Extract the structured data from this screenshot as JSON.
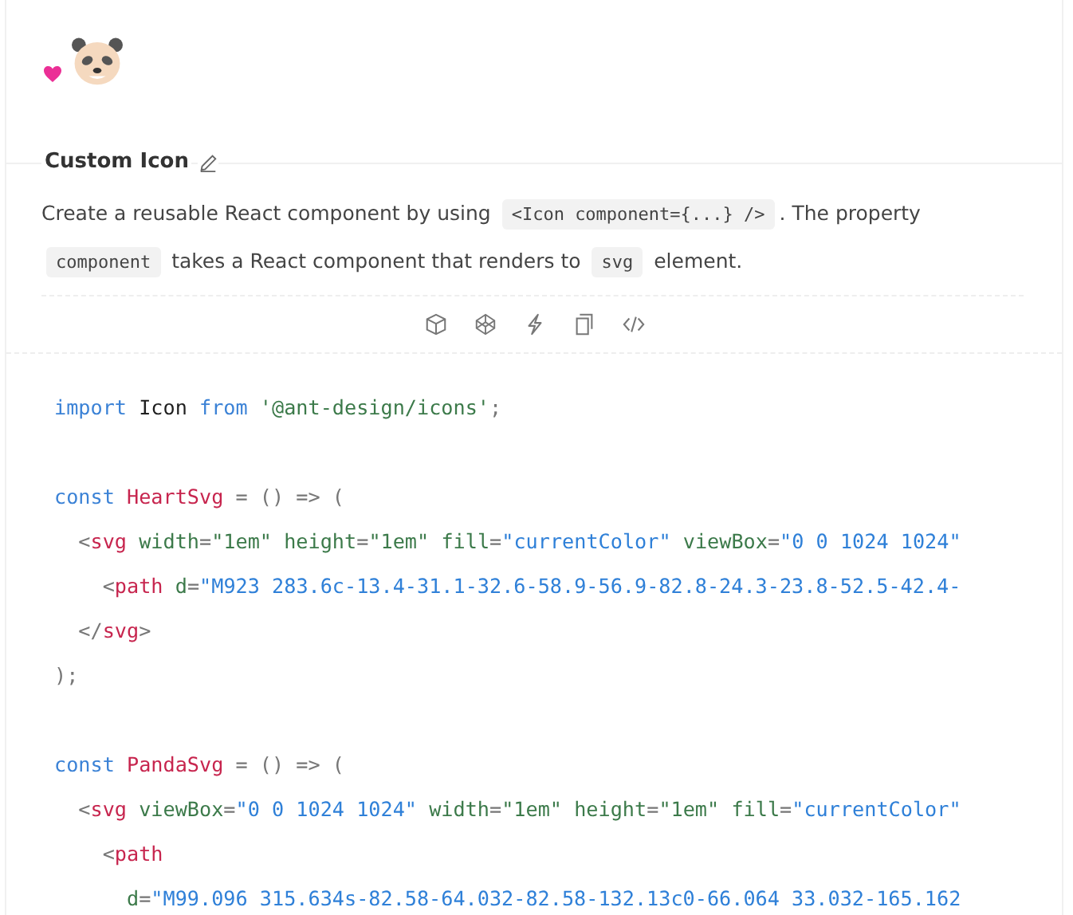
{
  "demo": {
    "icons": [
      {
        "kind": "heart"
      },
      {
        "kind": "panda"
      }
    ]
  },
  "section": {
    "title": "Custom Icon",
    "description": [
      "Create a reusable React component by using ",
      "<Icon component={...} />",
      ". The property ",
      "component",
      " takes a React component that renders to ",
      "svg",
      " element."
    ]
  },
  "actions": [
    {
      "kind": "codesandbox"
    },
    {
      "kind": "codepen"
    },
    {
      "kind": "stackblitz"
    },
    {
      "kind": "copy"
    },
    {
      "kind": "expand"
    }
  ],
  "code": [
    {
      "lines": [
        [
          {
            "kind": "keyword",
            "text": "import"
          },
          {
            "kind": "plain",
            "text": " Icon "
          },
          {
            "kind": "keyword",
            "text": "from"
          },
          {
            "kind": "string",
            "text": " '@ant-design/icons'"
          },
          {
            "kind": "punct",
            "text": ";"
          }
        ]
      ]
    },
    {
      "lines": [
        [
          {
            "kind": "keyword",
            "text": "const"
          },
          {
            "kind": "name",
            "text": " HeartSvg"
          },
          {
            "kind": "punct",
            "text": " = () => ("
          }
        ],
        [
          {
            "kind": "punct",
            "text": "  <"
          },
          {
            "kind": "tag",
            "text": "svg"
          },
          {
            "kind": "attr",
            "text": " width"
          },
          {
            "kind": "punct",
            "text": "="
          },
          {
            "kind": "string",
            "text": "\"1em\""
          },
          {
            "kind": "attr",
            "text": " height"
          },
          {
            "kind": "punct",
            "text": "="
          },
          {
            "kind": "string",
            "text": "\"1em\""
          },
          {
            "kind": "attr",
            "text": " fill"
          },
          {
            "kind": "punct",
            "text": "="
          },
          {
            "kind": "value",
            "text": "\"currentColor\""
          },
          {
            "kind": "attr",
            "text": " viewBox"
          },
          {
            "kind": "punct",
            "text": "="
          },
          {
            "kind": "value",
            "text": "\"0 0 1024 1024\""
          }
        ],
        [
          {
            "kind": "punct",
            "text": "    <"
          },
          {
            "kind": "tag",
            "text": "path"
          },
          {
            "kind": "attr",
            "text": " d"
          },
          {
            "kind": "punct",
            "text": "="
          },
          {
            "kind": "value",
            "text": "\"M923 283.6c-13.4-31.1-32.6-58.9-56.9-82.8-24.3-23.8-52.5-42.4-"
          }
        ],
        [
          {
            "kind": "punct",
            "text": "  </"
          },
          {
            "kind": "tag",
            "text": "svg"
          },
          {
            "kind": "punct",
            "text": ">"
          }
        ],
        [
          {
            "kind": "punct",
            "text": ");"
          }
        ]
      ]
    },
    {
      "lines": [
        [
          {
            "kind": "keyword",
            "text": "const"
          },
          {
            "kind": "name",
            "text": " PandaSvg"
          },
          {
            "kind": "punct",
            "text": " = () => ("
          }
        ],
        [
          {
            "kind": "punct",
            "text": "  <"
          },
          {
            "kind": "tag",
            "text": "svg"
          },
          {
            "kind": "attr",
            "text": " viewBox"
          },
          {
            "kind": "punct",
            "text": "="
          },
          {
            "kind": "value",
            "text": "\"0 0 1024 1024\""
          },
          {
            "kind": "attr",
            "text": " width"
          },
          {
            "kind": "punct",
            "text": "="
          },
          {
            "kind": "string",
            "text": "\"1em\""
          },
          {
            "kind": "attr",
            "text": " height"
          },
          {
            "kind": "punct",
            "text": "="
          },
          {
            "kind": "string",
            "text": "\"1em\""
          },
          {
            "kind": "attr",
            "text": " fill"
          },
          {
            "kind": "punct",
            "text": "="
          },
          {
            "kind": "value",
            "text": "\"currentColor\""
          }
        ],
        [
          {
            "kind": "punct",
            "text": "    <"
          },
          {
            "kind": "tag",
            "text": "path"
          }
        ],
        [
          {
            "kind": "attr",
            "text": "      d"
          },
          {
            "kind": "punct",
            "text": "="
          },
          {
            "kind": "value",
            "text": "\"M99.096 315.634s-82.58-64.032-82.58-132.13c0-66.064 33.032-165.162"
          }
        ]
      ]
    }
  ]
}
